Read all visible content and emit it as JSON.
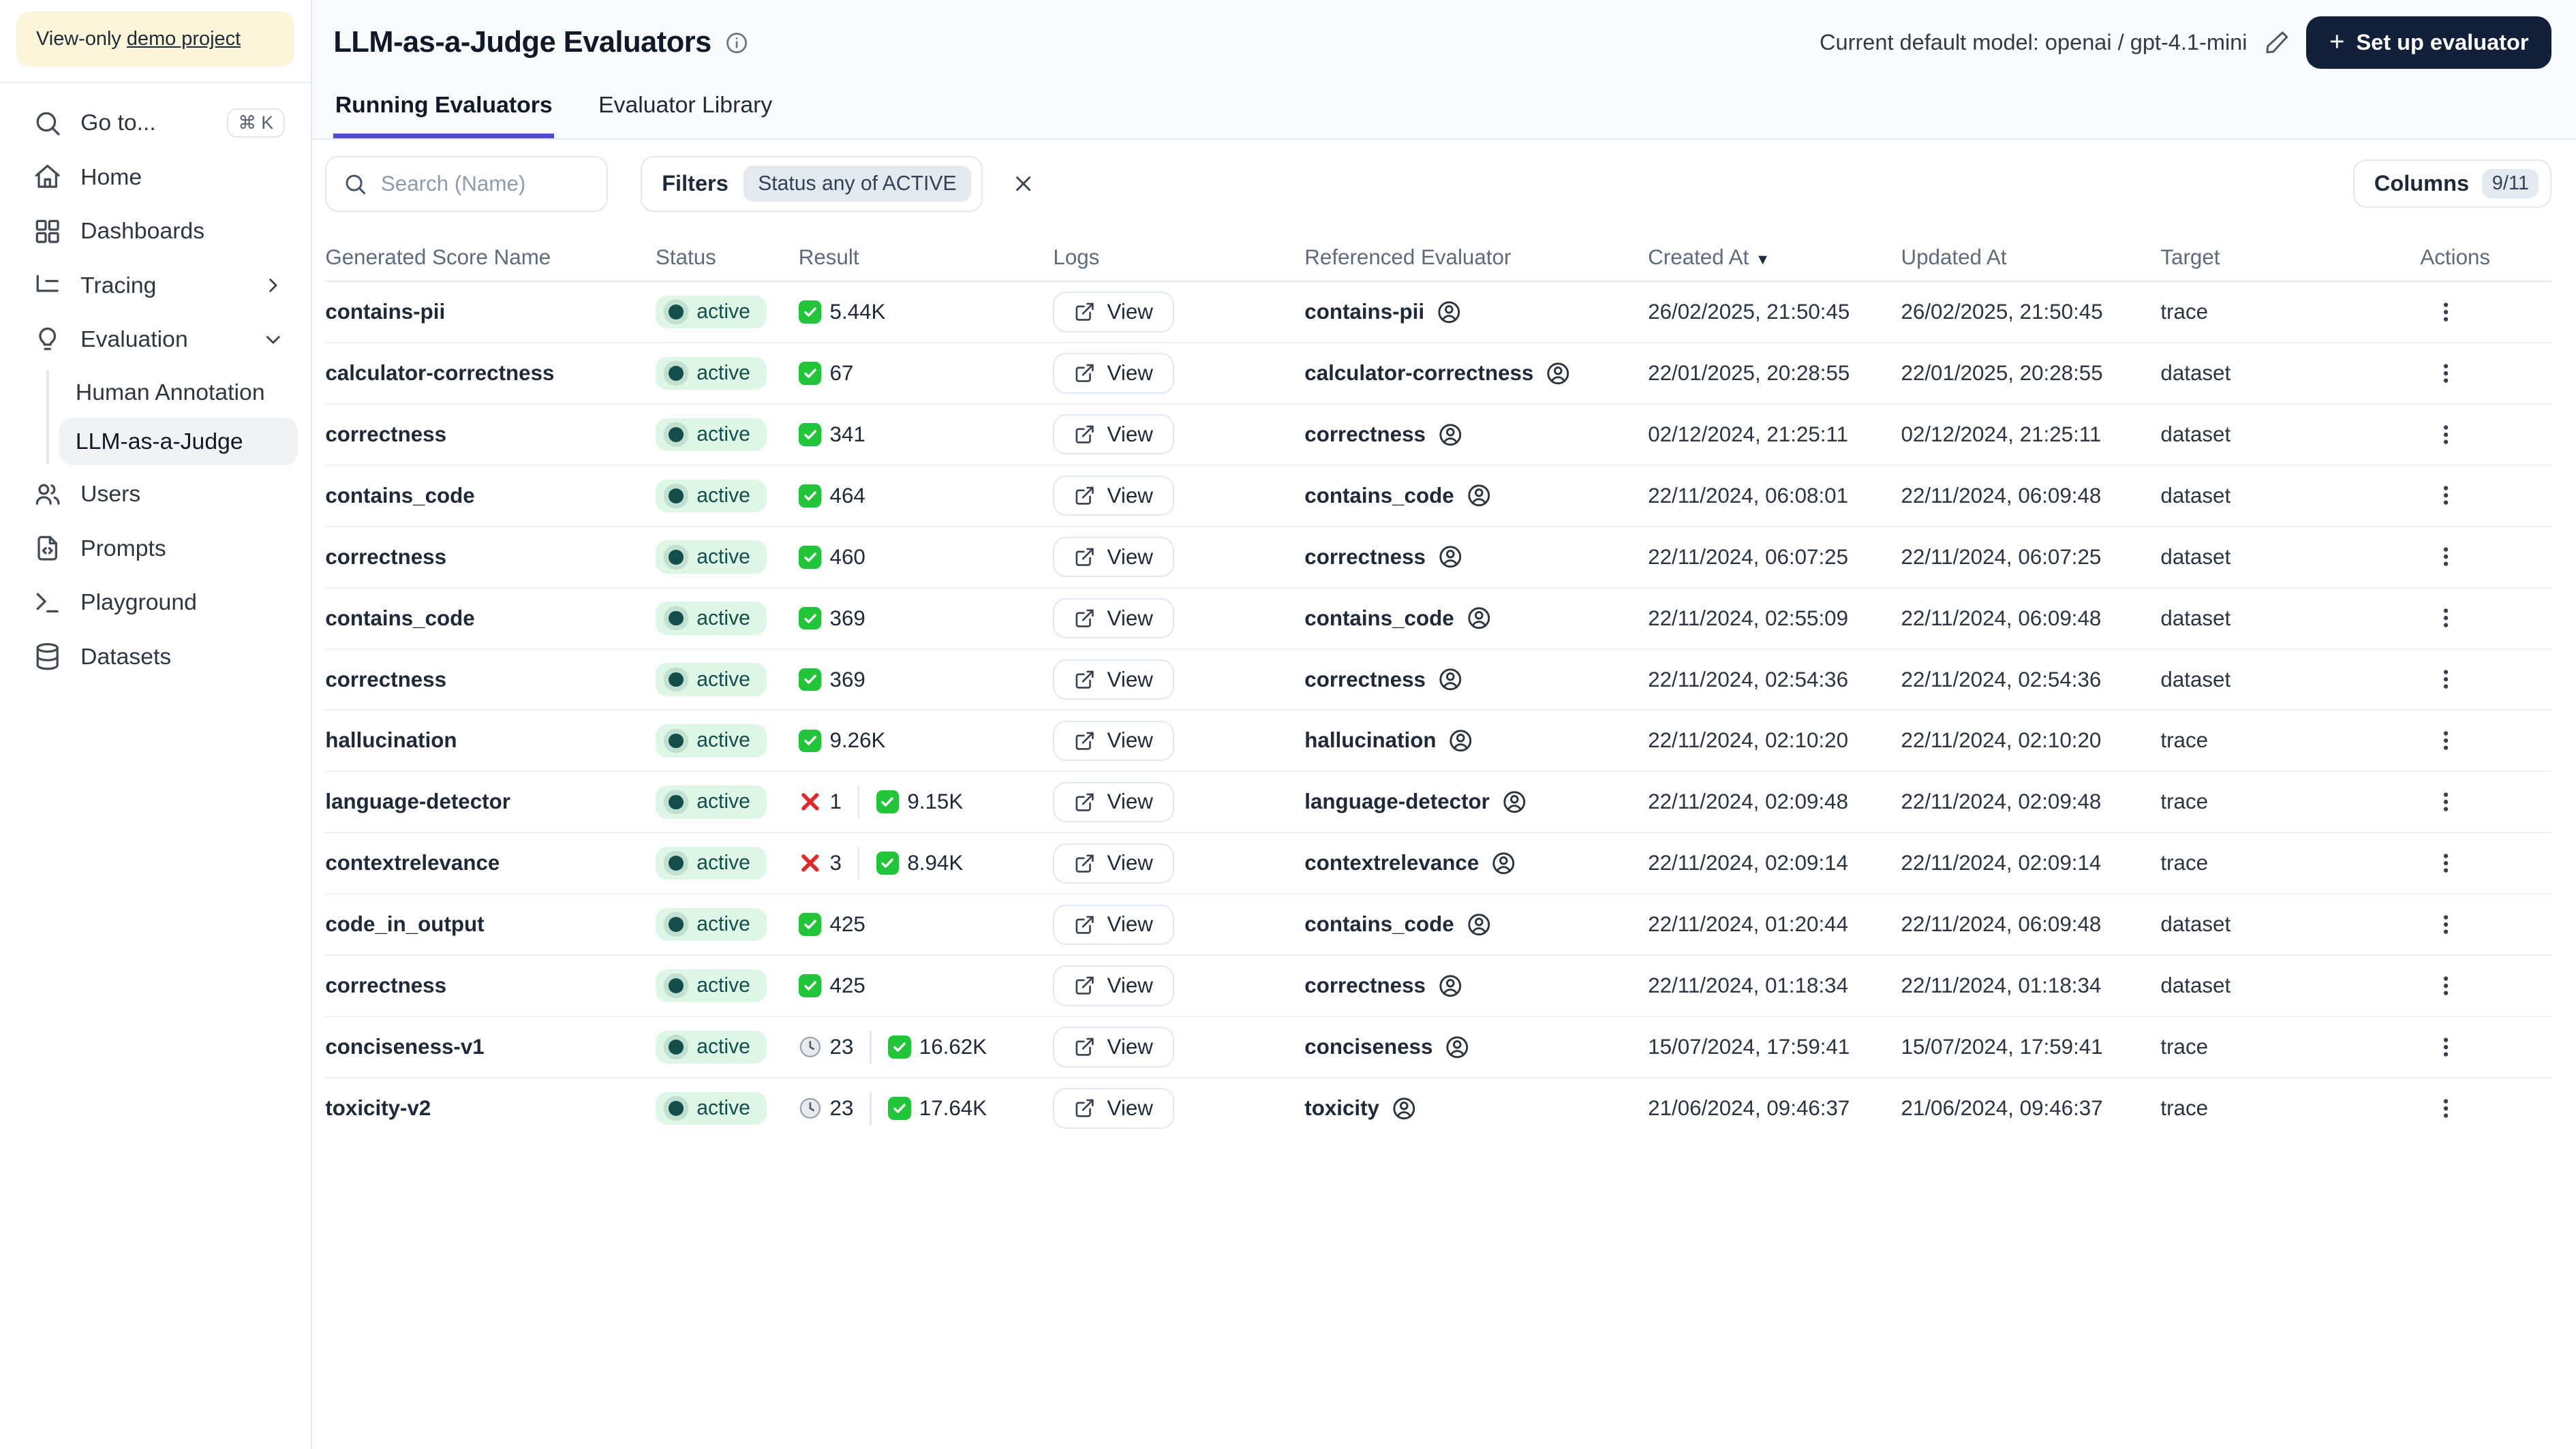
{
  "colors": {
    "accent_tab": "#4f4bd8",
    "setup_button_bg": "#13203a",
    "active_badge_bg": "#ddf6e6",
    "active_badge_text": "#134e4a",
    "pass_green": "#22c53a",
    "fail_red": "#dd2b2b",
    "banner_bg": "#fbf6da"
  },
  "sidebar": {
    "banner": {
      "prefix": "View-only ",
      "link_label": "demo project"
    },
    "goto": {
      "label": "Go to...",
      "shortcut": "⌘ K"
    },
    "home": {
      "label": "Home"
    },
    "dashboards": {
      "label": "Dashboards"
    },
    "tracing": {
      "label": "Tracing"
    },
    "evaluation": {
      "label": "Evaluation"
    },
    "human_annotation": {
      "label": "Human Annotation"
    },
    "llm_judge": {
      "label": "LLM-as-a-Judge"
    },
    "users": {
      "label": "Users"
    },
    "prompts": {
      "label": "Prompts"
    },
    "playground": {
      "label": "Playground"
    },
    "datasets": {
      "label": "Datasets"
    }
  },
  "header": {
    "title": "LLM-as-a-Judge Evaluators",
    "model_label": "Current default model: openai / gpt-4.1-mini",
    "setup_button_label": "Set up evaluator",
    "setup_button_plus": "+"
  },
  "tabs": {
    "running": "Running Evaluators",
    "library": "Evaluator Library"
  },
  "toolbar": {
    "search_placeholder": "Search (Name)",
    "filters_label": "Filters",
    "filter_chip": "Status any of ACTIVE",
    "columns_label": "Columns",
    "columns_badge": "9/11"
  },
  "table": {
    "headers": [
      "Generated Score Name",
      "Status",
      "Result",
      "Logs",
      "Referenced Evaluator",
      "Created At",
      "Updated At",
      "Target",
      "Actions"
    ],
    "sort_indicator": "▼",
    "rows": [
      {
        "name": "contains-pii",
        "status": "active",
        "result": {
          "pass": "5.44K"
        },
        "logs": "View",
        "referenced": "contains-pii",
        "created": "26/02/2025, 21:50:45",
        "updated": "26/02/2025, 21:50:45",
        "target": "trace"
      },
      {
        "name": "calculator-correctness",
        "status": "active",
        "result": {
          "pass": "67"
        },
        "logs": "View",
        "referenced": "calculator-correctness",
        "created": "22/01/2025, 20:28:55",
        "updated": "22/01/2025, 20:28:55",
        "target": "dataset"
      },
      {
        "name": "correctness",
        "status": "active",
        "result": {
          "pass": "341"
        },
        "logs": "View",
        "referenced": "correctness",
        "created": "02/12/2024, 21:25:11",
        "updated": "02/12/2024, 21:25:11",
        "target": "dataset"
      },
      {
        "name": "contains_code",
        "status": "active",
        "result": {
          "pass": "464"
        },
        "logs": "View",
        "referenced": "contains_code",
        "created": "22/11/2024, 06:08:01",
        "updated": "22/11/2024, 06:09:48",
        "target": "dataset"
      },
      {
        "name": "correctness",
        "status": "active",
        "result": {
          "pass": "460"
        },
        "logs": "View",
        "referenced": "correctness",
        "created": "22/11/2024, 06:07:25",
        "updated": "22/11/2024, 06:07:25",
        "target": "dataset"
      },
      {
        "name": "contains_code",
        "status": "active",
        "result": {
          "pass": "369"
        },
        "logs": "View",
        "referenced": "contains_code",
        "created": "22/11/2024, 02:55:09",
        "updated": "22/11/2024, 06:09:48",
        "target": "dataset"
      },
      {
        "name": "correctness",
        "status": "active",
        "result": {
          "pass": "369"
        },
        "logs": "View",
        "referenced": "correctness",
        "created": "22/11/2024, 02:54:36",
        "updated": "22/11/2024, 02:54:36",
        "target": "dataset"
      },
      {
        "name": "hallucination",
        "status": "active",
        "result": {
          "pass": "9.26K"
        },
        "logs": "View",
        "referenced": "hallucination",
        "created": "22/11/2024, 02:10:20",
        "updated": "22/11/2024, 02:10:20",
        "target": "trace"
      },
      {
        "name": "language-detector",
        "status": "active",
        "result": {
          "fail": "1",
          "pass": "9.15K"
        },
        "logs": "View",
        "referenced": "language-detector",
        "created": "22/11/2024, 02:09:48",
        "updated": "22/11/2024, 02:09:48",
        "target": "trace"
      },
      {
        "name": "contextrelevance",
        "status": "active",
        "result": {
          "fail": "3",
          "pass": "8.94K"
        },
        "logs": "View",
        "referenced": "contextrelevance",
        "created": "22/11/2024, 02:09:14",
        "updated": "22/11/2024, 02:09:14",
        "target": "trace"
      },
      {
        "name": "code_in_output",
        "status": "active",
        "result": {
          "pass": "425"
        },
        "logs": "View",
        "referenced": "contains_code",
        "created": "22/11/2024, 01:20:44",
        "updated": "22/11/2024, 06:09:48",
        "target": "dataset"
      },
      {
        "name": "correctness",
        "status": "active",
        "result": {
          "pass": "425"
        },
        "logs": "View",
        "referenced": "correctness",
        "created": "22/11/2024, 01:18:34",
        "updated": "22/11/2024, 01:18:34",
        "target": "dataset"
      },
      {
        "name": "conciseness-v1",
        "status": "active",
        "result": {
          "pending": "23",
          "pass": "16.62K"
        },
        "logs": "View",
        "referenced": "conciseness",
        "created": "15/07/2024, 17:59:41",
        "updated": "15/07/2024, 17:59:41",
        "target": "trace"
      },
      {
        "name": "toxicity-v2",
        "status": "active",
        "result": {
          "pending": "23",
          "pass": "17.64K"
        },
        "logs": "View",
        "referenced": "toxicity",
        "created": "21/06/2024, 09:46:37",
        "updated": "21/06/2024, 09:46:37",
        "target": "trace"
      }
    ]
  }
}
